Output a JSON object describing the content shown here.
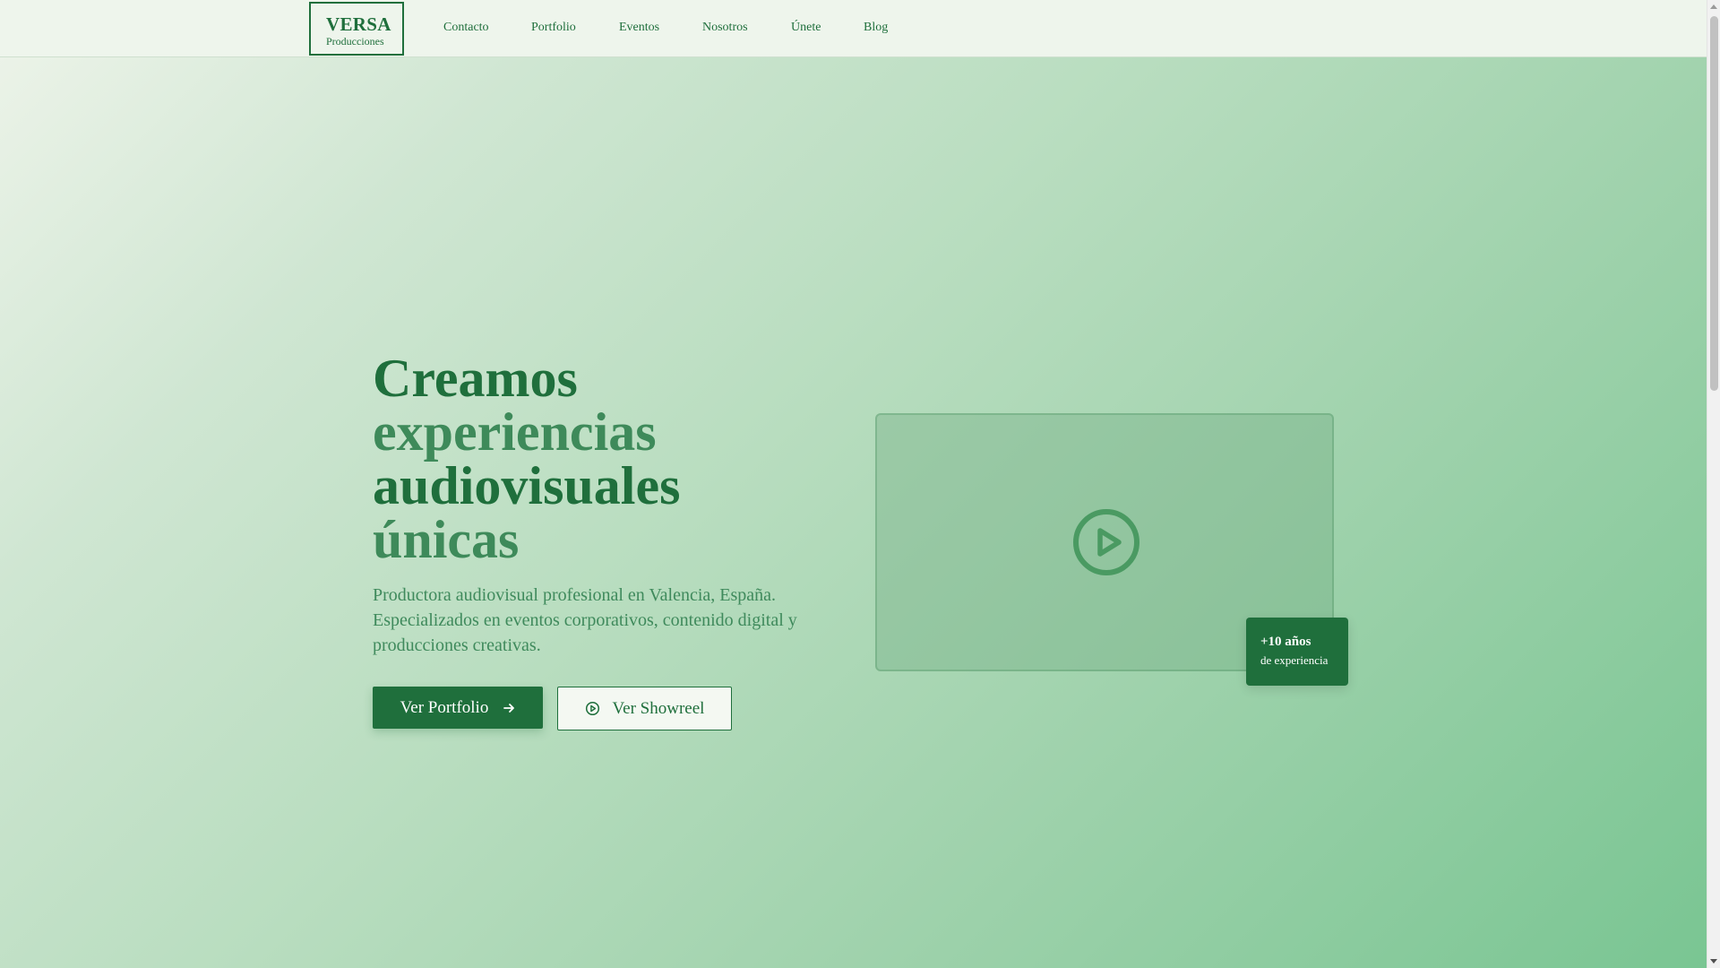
{
  "header": {
    "logo_title": "VERSA",
    "logo_subtitle": "Producciones",
    "nav": [
      "Contacto",
      "Portfolio",
      "Eventos",
      "Nosotros",
      "Únete",
      "Blog"
    ]
  },
  "hero": {
    "title_lines": [
      "Creamos",
      "experiencias",
      "audiovisuales",
      "únicas"
    ],
    "description": "Productora audiovisual profesional en Valencia, España. Especializados en eventos corporativos, contenido digital y producciones creativas.",
    "primary_button": "Ver Portfolio",
    "secondary_button": "Ver Showreel"
  },
  "video": {
    "icon": "play-circle-icon",
    "badge_title": "+10 años",
    "badge_subtitle": "de experiencia"
  },
  "icons": {
    "primary_button_icon": "arrow-right-icon",
    "secondary_button_icon": "play-circle-icon"
  },
  "colors": {
    "brand": "#1f6f3c",
    "brand_light": "#3e8a5a",
    "header_bg": "#eef5ec",
    "gradient_start": "#eef4ea",
    "gradient_end": "#79c592"
  }
}
